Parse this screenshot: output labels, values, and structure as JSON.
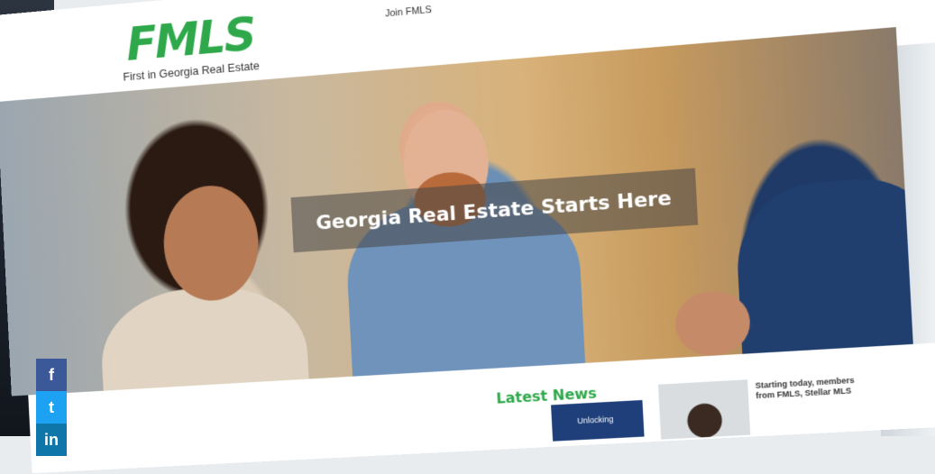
{
  "header": {
    "logo_text": "FMLS",
    "tagline": "First in Georgia Real Estate",
    "top_link": "Join FMLS"
  },
  "hero": {
    "title": "Georgia Real Estate Starts Here"
  },
  "social": [
    {
      "label": "f",
      "icon": "facebook-icon"
    },
    {
      "label": "t",
      "icon": "twitter-icon"
    },
    {
      "label": "in",
      "icon": "linkedin-icon"
    }
  ],
  "news": {
    "heading": "Latest News",
    "card1_text": "Unlocking",
    "card2_text": "Starting today, members from FMLS, Stellar MLS"
  },
  "colors": {
    "brand_green": "#2ea84a",
    "banner_overlay": "rgba(70,70,70,0.55)",
    "news_card_blue": "#1f3f7a"
  }
}
